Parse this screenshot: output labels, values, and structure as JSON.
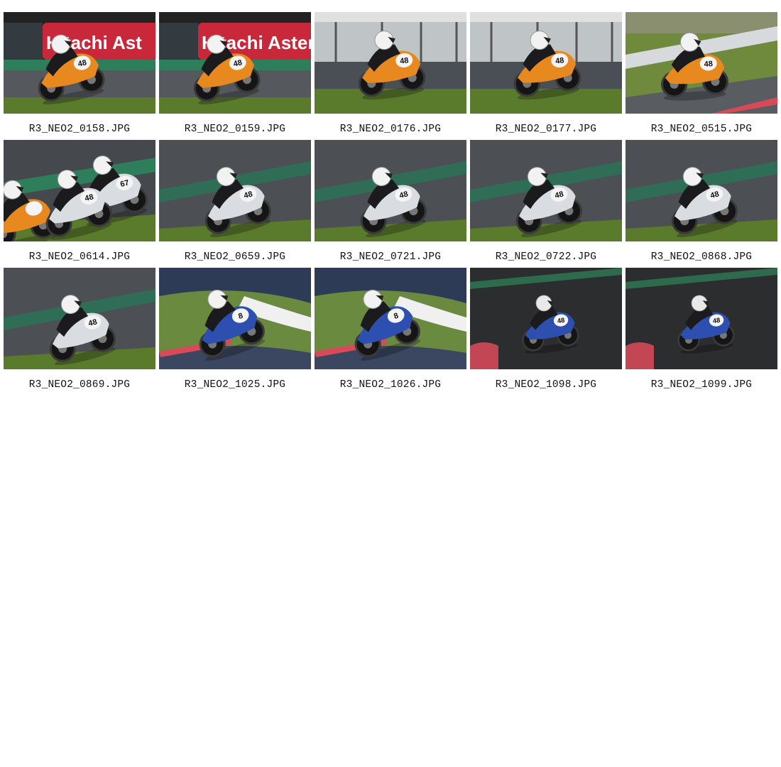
{
  "photos": [
    {
      "filename": "R3_NEO2_0158.JPG",
      "number": "48",
      "scene": "banner-orange",
      "banner_text": "Hitachi Ast"
    },
    {
      "filename": "R3_NEO2_0159.JPG",
      "number": "48",
      "scene": "banner-orange",
      "banner_text": "Hitachi Astem"
    },
    {
      "filename": "R3_NEO2_0176.JPG",
      "number": "48",
      "scene": "fence-orange"
    },
    {
      "filename": "R3_NEO2_0177.JPG",
      "number": "48",
      "scene": "fence-orange"
    },
    {
      "filename": "R3_NEO2_0515.JPG",
      "number": "48",
      "scene": "grass-orange"
    },
    {
      "filename": "R3_NEO2_0614.JPG",
      "number": "48",
      "scene": "track-white-pair"
    },
    {
      "filename": "R3_NEO2_0659.JPG",
      "number": "48",
      "scene": "track-white"
    },
    {
      "filename": "R3_NEO2_0721.JPG",
      "number": "48",
      "scene": "track-white"
    },
    {
      "filename": "R3_NEO2_0722.JPG",
      "number": "48",
      "scene": "track-white"
    },
    {
      "filename": "R3_NEO2_0868.JPG",
      "number": "48",
      "scene": "track-white"
    },
    {
      "filename": "R3_NEO2_0869.JPG",
      "number": "48",
      "scene": "track-white"
    },
    {
      "filename": "R3_NEO2_1025.JPG",
      "number": "8",
      "scene": "curb-blue"
    },
    {
      "filename": "R3_NEO2_1026.JPG",
      "number": "8",
      "scene": "curb-blue"
    },
    {
      "filename": "R3_NEO2_1098.JPG",
      "number": "48",
      "scene": "dark-blue"
    },
    {
      "filename": "R3_NEO2_1099.JPG",
      "number": "48",
      "scene": "dark-blue"
    }
  ],
  "colors": {
    "orange": "#e8891f",
    "white_fairing": "#d9dde2",
    "blue_fairing": "#2c4fb0",
    "banner_red": "#c9283a",
    "grass": "#5a7a2c",
    "asphalt": "#3a3d40",
    "kerb_green": "#2e7d5b"
  }
}
